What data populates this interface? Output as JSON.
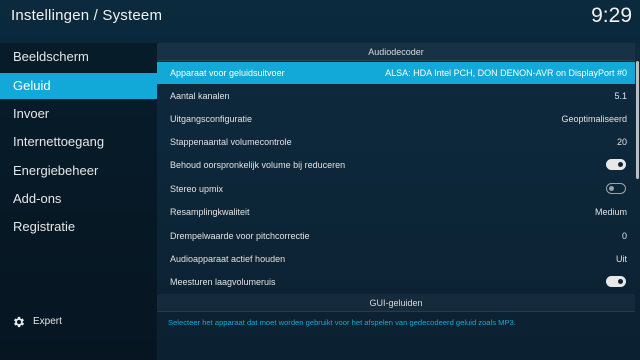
{
  "header": {
    "title": "Instellingen / Systeem",
    "clock": "9:29"
  },
  "sidebar": {
    "items": [
      {
        "label": "Beeldscherm",
        "active": false
      },
      {
        "label": "Geluid",
        "active": true
      },
      {
        "label": "Invoer",
        "active": false
      },
      {
        "label": "Internettoegang",
        "active": false
      },
      {
        "label": "Energiebeheer",
        "active": false
      },
      {
        "label": "Add-ons",
        "active": false
      },
      {
        "label": "Registratie",
        "active": false
      }
    ],
    "expert_label": "Expert",
    "expert_icon": "gear-icon"
  },
  "sections": {
    "audio_header": "Audiodecoder",
    "gui_header": "GUI-geluiden"
  },
  "settings": [
    {
      "label": "Apparaat voor geluidsuitvoer",
      "value": "ALSA: HDA Intel PCH, DON DENON-AVR on DisplayPort #0",
      "active": true
    },
    {
      "label": "Aantal kanalen",
      "value": "5.1"
    },
    {
      "label": "Uitgangsconfiguratie",
      "value": "Geoptimaliseerd"
    },
    {
      "label": "Stappenaantal volumecontrole",
      "value": "20"
    },
    {
      "label": "Behoud oorspronkelijk volume bij reduceren",
      "toggle": "on"
    },
    {
      "label": "Stereo upmix",
      "toggle": "off"
    },
    {
      "label": "Resamplingkwaliteit",
      "value": "Medium"
    },
    {
      "label": "Drempelwaarde voor pitchcorrectie",
      "value": "0"
    },
    {
      "label": "Audioapparaat actief houden",
      "value": "Uit"
    },
    {
      "label": "Meesturen laagvolumeruis",
      "toggle": "on"
    }
  ],
  "description": "Selecteer het apparaat dat moet worden gebruikt voor het afspelen van gedecodeerd geluid zoals MP3.",
  "colors": {
    "accent": "#12a9d8",
    "background": "#0a2436"
  }
}
